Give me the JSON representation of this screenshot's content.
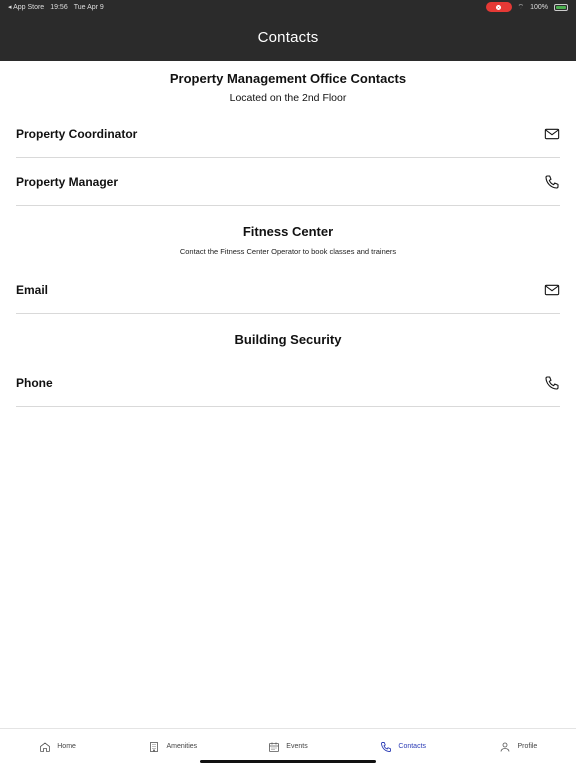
{
  "status_bar": {
    "back_app": "◂ App Store",
    "time": "19:56",
    "date": "Tue Apr 9",
    "battery": "100%"
  },
  "header": {
    "title": "Contacts"
  },
  "sections": {
    "management": {
      "title": "Property Management Office Contacts",
      "subtitle": "Located on the 2nd Floor",
      "rows": [
        {
          "label": "Property Coordinator",
          "icon": "mail-icon"
        },
        {
          "label": "Property Manager",
          "icon": "phone-icon"
        }
      ]
    },
    "fitness": {
      "title": "Fitness Center",
      "note": "Contact the Fitness Center Operator to book classes and trainers",
      "rows": [
        {
          "label": "Email",
          "icon": "mail-icon"
        }
      ]
    },
    "security": {
      "title": "Building Security",
      "rows": [
        {
          "label": "Phone",
          "icon": "phone-icon"
        }
      ]
    }
  },
  "tab_bar": {
    "items": [
      {
        "label": "Home",
        "icon": "home-icon"
      },
      {
        "label": "Amenities",
        "icon": "building-icon"
      },
      {
        "label": "Events",
        "icon": "calendar-icon"
      },
      {
        "label": "Contacts",
        "icon": "phone-icon",
        "active": true
      },
      {
        "label": "Profile",
        "icon": "person-icon"
      }
    ]
  },
  "colors": {
    "header_bg": "#2b2b2b",
    "active_tab": "#2a3bb5",
    "record": "#e53935"
  }
}
